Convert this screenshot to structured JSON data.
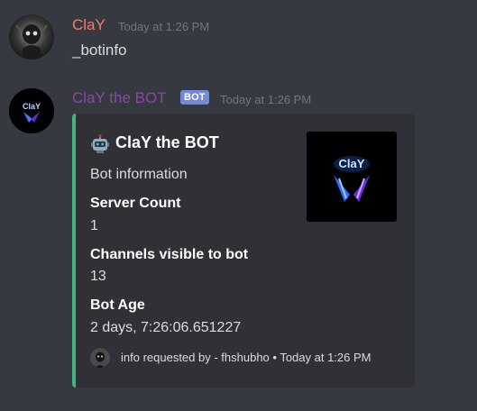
{
  "messages": [
    {
      "author": "ClaY",
      "author_color": "#f47b67",
      "timestamp": "Today at 1:26 PM",
      "content": "_botinfo"
    },
    {
      "author": "ClaY the BOT",
      "author_color": "#8e44ad",
      "badge": "BOT",
      "timestamp": "Today at 1:26 PM",
      "embed": {
        "accent_color": "#43b581",
        "title": "ClaY the BOT",
        "title_icon": "robot-icon",
        "description": "Bot information",
        "fields": [
          {
            "name": "Server Count",
            "value": "1"
          },
          {
            "name": "Channels visible to bot",
            "value": "13"
          },
          {
            "name": "Bot Age",
            "value": "2 days, 7:26:06.651227"
          }
        ],
        "thumbnail_text": "ClaY",
        "footer": "info requested by - fhshubho • Today at 1:26 PM"
      }
    }
  ]
}
